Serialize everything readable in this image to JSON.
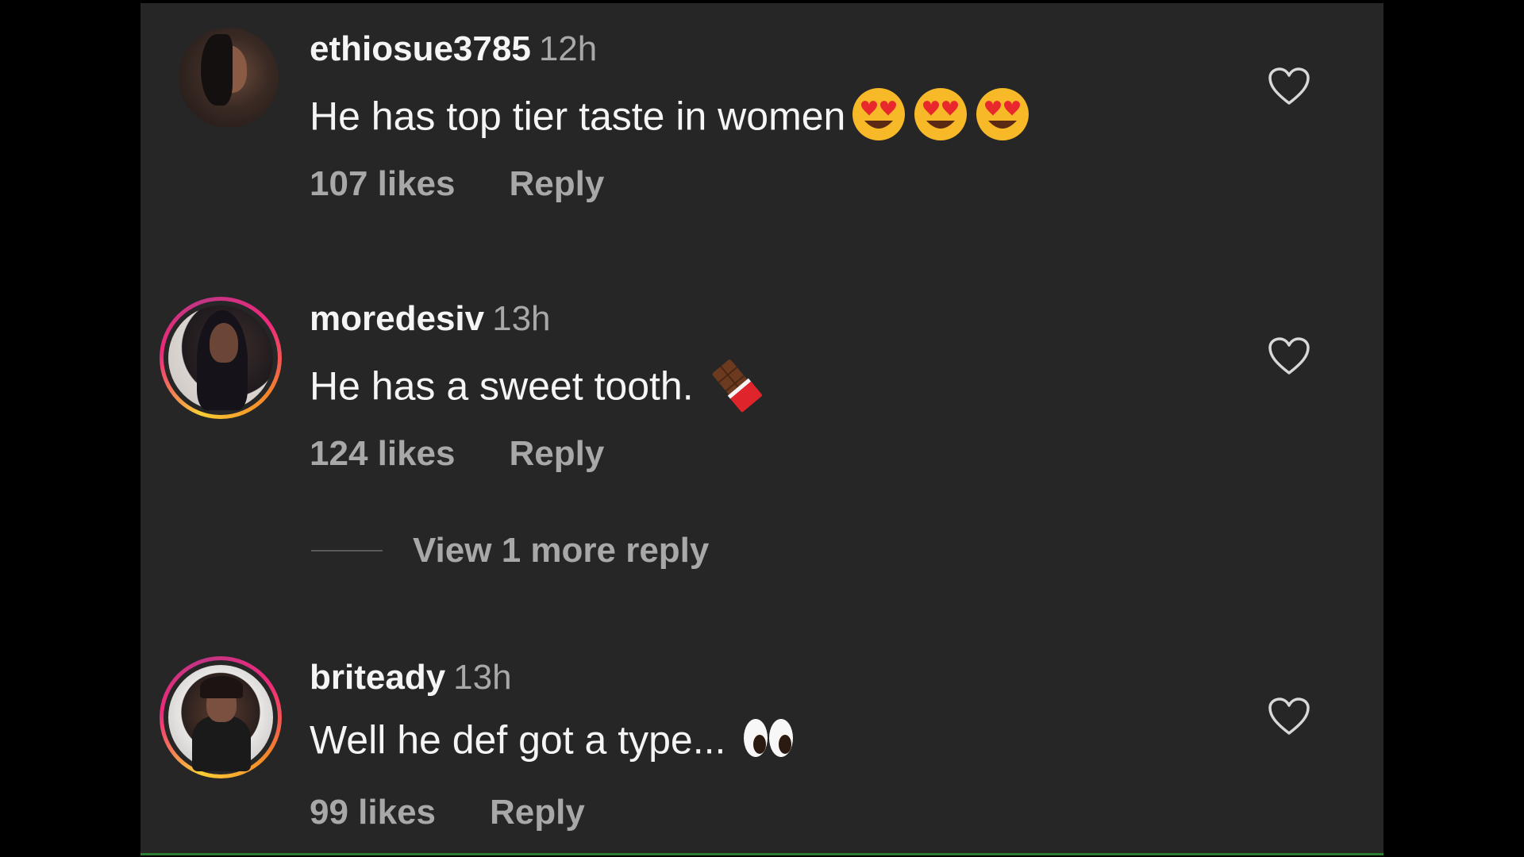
{
  "comments": [
    {
      "username": "ethiosue3785",
      "time": "12h",
      "text": "He has top tier taste in women",
      "emoji": [
        "heart-eyes",
        "heart-eyes",
        "heart-eyes"
      ],
      "likes": "107 likes",
      "reply_label": "Reply",
      "avatar_ring": false
    },
    {
      "username": "moredesiv",
      "time": "13h",
      "text": "He has a sweet tooth.",
      "emoji": [
        "chocolate-bar"
      ],
      "likes": "124 likes",
      "reply_label": "Reply",
      "avatar_ring": true,
      "view_more": "View 1 more reply"
    },
    {
      "username": "briteady",
      "time": "13h",
      "text": "Well he def got a type...",
      "emoji": [
        "eyes"
      ],
      "likes": "99 likes",
      "reply_label": "Reply",
      "avatar_ring": true
    }
  ],
  "colors": {
    "background": "#262626",
    "text": "#f5f5f5",
    "secondary_text": "#a8a8a8",
    "story_ring": [
      "#f9ce34",
      "#ee2a7b",
      "#c13584"
    ]
  }
}
